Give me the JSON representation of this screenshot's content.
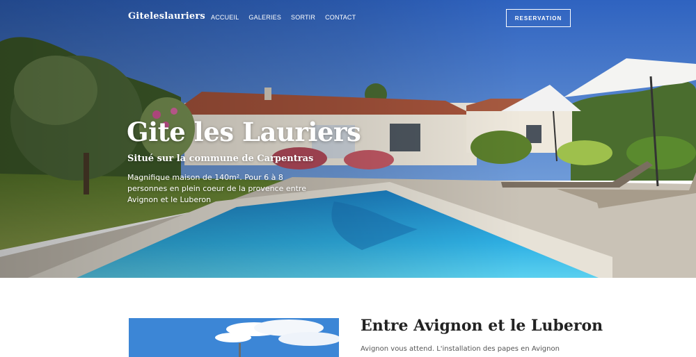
{
  "header": {
    "brand": "Giteleslauriers",
    "menu": [
      "ACCUEIL",
      "GALERIES",
      "SORTIR",
      "CONTACT"
    ],
    "cta": "RESERVATION"
  },
  "hero": {
    "title": "Gite les Lauriers",
    "subtitle": "Situé sur la commune de Carpentras",
    "description": "Magnifique maison de 140m². Pour 6 à 8 personnes en plein coeur de la provence entre Avignon et le Luberon"
  },
  "intro": {
    "title": "Entre Avignon et le Luberon",
    "text": "Avignon vous attend. L'installation des papes en Avignon au XIVe siècle a marqué de son empreinte l'histoire de la ville. De l'époque"
  },
  "colors": {
    "sky": "#3a6fc6",
    "pool": "#2aa0d8",
    "white": "#ffffff"
  }
}
